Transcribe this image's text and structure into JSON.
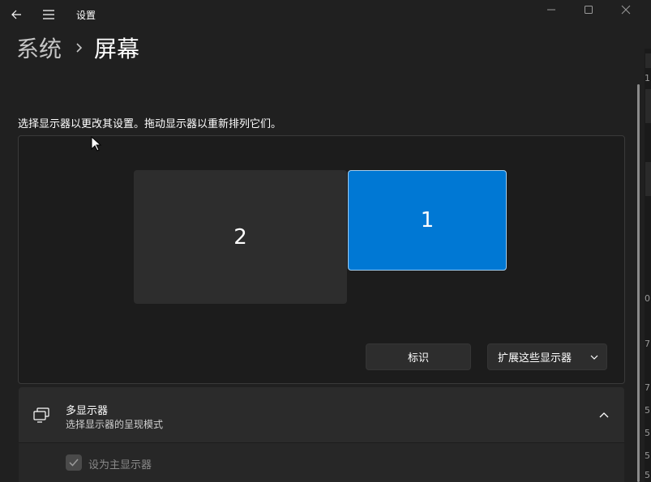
{
  "titlebar": {
    "app_title": "设置",
    "back_icon": "arrow-left-icon",
    "menu_icon": "hamburger-icon",
    "window_buttons": [
      "minimize-icon",
      "maximize-icon",
      "close-icon"
    ]
  },
  "breadcrumb": {
    "parent": "系统",
    "separator_icon": "chevron-right-icon",
    "current": "屏幕"
  },
  "instruction": "选择显示器以更改其设置。拖动显示器以重新排列它们。",
  "arrangement": {
    "monitors": [
      {
        "number": "2",
        "selected": false,
        "color": "#2d2d2d"
      },
      {
        "number": "1",
        "selected": true,
        "color": "#0078d4"
      }
    ],
    "identify_label": "标识",
    "mode_select_value": "扩展这些显示器",
    "mode_select_icon": "chevron-down-icon"
  },
  "multi_display": {
    "icon": "multiple-displays-icon",
    "title": "多显示器",
    "subtitle": "选择显示器的呈现模式",
    "expand_icon": "chevron-up-icon",
    "primary_checkbox": {
      "label": "设为主显示器",
      "checked": true,
      "disabled": true
    }
  },
  "colors": {
    "background": "#202020",
    "accent": "#0078d4",
    "card": "#2b2b2b",
    "panel": "#1c1c1c"
  },
  "edge_strip_chars": [
    "1",
    "0",
    "7",
    "7",
    "5",
    "5",
    "5",
    "5"
  ]
}
